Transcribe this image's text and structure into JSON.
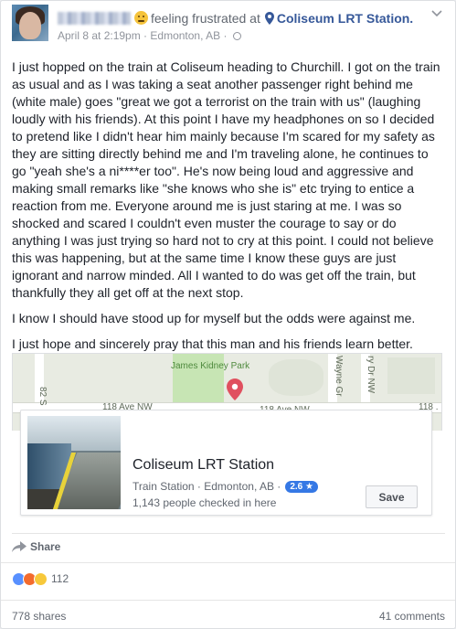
{
  "post": {
    "author_redacted": true,
    "feeling_text": "feeling frustrated at",
    "place_link": "Coliseum LRT Station.",
    "date_text": "April 8 at 2:19pm",
    "location_text": "Edmonton, AB",
    "meta_separator": " · ",
    "paragraphs": [
      "I just hopped on the train at Coliseum heading to Churchill. I got on the train as usual and as I was taking a seat another passenger right behind me (white male) goes \"great we got a terrorist on the train with us\" (laughing loudly with his friends). At this point I have my headphones on so I decided to pretend like I didn't hear him mainly because I'm scared for my safety as they are sitting directly behind me and I'm traveling alone, he continues to go \"yeah she's a ni****er too\". He's now being loud and aggressive and making small remarks like \"she knows who she is\" etc trying to entice a reaction from me. Everyone around me is just staring at me. I was so shocked and scared I couldn't even muster the courage to say or do anything I was just trying so hard not to cry at this point. I could not believe this was happening, but at the same time I know these guys are just ignorant and narrow minded. All I wanted to do was get off the train, but thankfully they all get off at the next stop.",
      "I know I should have stood up for myself but the odds were against me.",
      "I just hope and sincerely pray that this man and his friends learn better."
    ]
  },
  "map": {
    "park_label": "James Kidney Park",
    "road_label_1": "118 Ave NW",
    "road_label_2": "118 Ave NW",
    "road_label_3": "118 .",
    "vertical_label_82": "82 S",
    "vertical_label_wayne": "Wayne Gr",
    "vertical_label_ry": "ry Dr NW"
  },
  "place": {
    "name": "Coliseum LRT Station",
    "category_line": "Train Station · Edmonton, AB ·",
    "rating": "2.6 ★",
    "checkins": "1,143 people checked in here",
    "save_label": "Save"
  },
  "actions": {
    "share_label": "Share"
  },
  "engagement": {
    "reaction_count": "112",
    "shares": "778 shares",
    "comments": "41 comments"
  },
  "colors": {
    "link": "#365899",
    "rating_badge": "#3578e5",
    "like": "#5890ff",
    "angry": "#f36b2d",
    "sad": "#f7c83a"
  }
}
